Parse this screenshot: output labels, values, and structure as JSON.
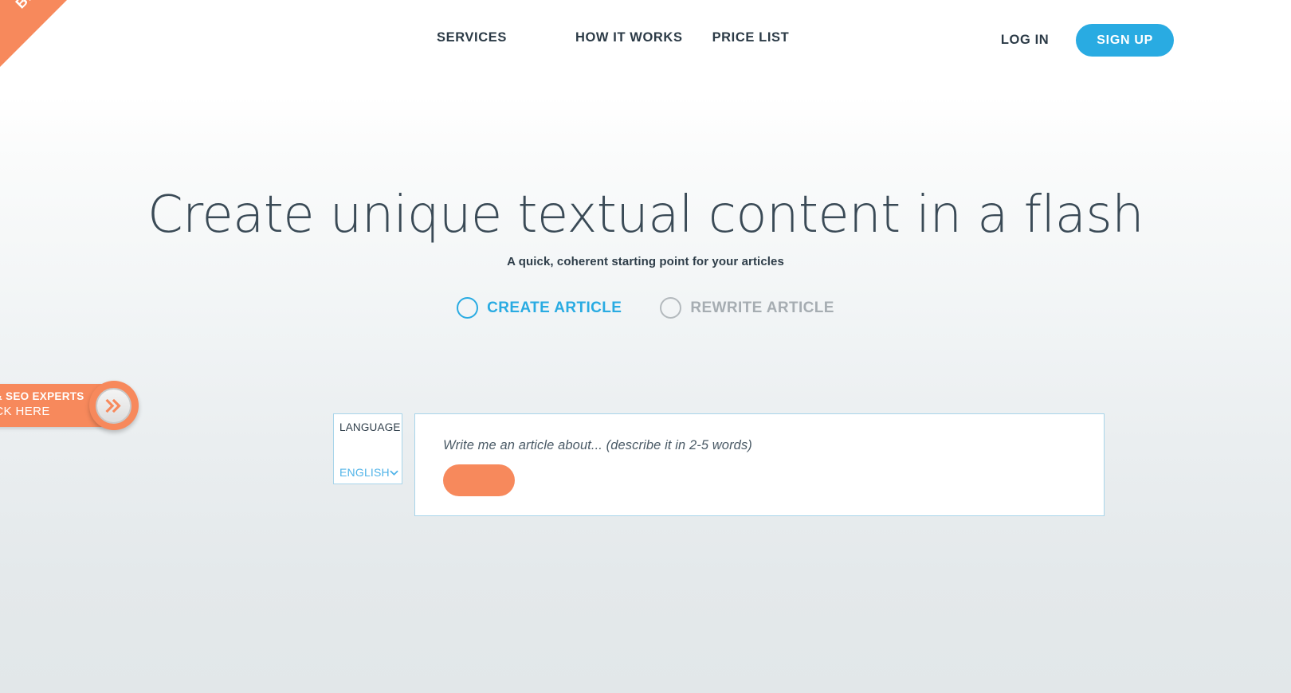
{
  "ribbon": {
    "label": "BETA"
  },
  "header": {
    "nav": [
      {
        "label": "SERVICES",
        "name": "nav-services"
      },
      {
        "label": "HOW IT WORKS",
        "name": "nav-how-it-works"
      },
      {
        "label": "PRICE LIST",
        "name": "nav-price-list"
      }
    ],
    "login_label": "LOG IN",
    "signup_label": "SIGN UP"
  },
  "hero": {
    "title": "Create unique textual content in a flash",
    "subtitle": "A quick, coherent starting point for your articles"
  },
  "modes": [
    {
      "label": "CREATE ARTICLE",
      "selected": true
    },
    {
      "label": "REWRITE ARTICLE",
      "selected": false
    }
  ],
  "language": {
    "label": "LANGUAGE",
    "selected": "ENGLISH",
    "chevron_icon": "chevron-down-icon"
  },
  "composer": {
    "placeholder": "Write me an article about... (describe it in 2-5 words)",
    "value": "",
    "generate_label": ""
  },
  "promo": {
    "line1": "GENCIES & SEO EXPERTS",
    "line2": "CLICK HERE",
    "knob_icon": "double-chevron-right-icon"
  },
  "colors": {
    "accent_blue": "#29abe2",
    "accent_orange": "#f7895c",
    "text_dark": "#2e3d49",
    "muted_gray": "#a6adb2",
    "panel_border": "#a8d5ea"
  }
}
